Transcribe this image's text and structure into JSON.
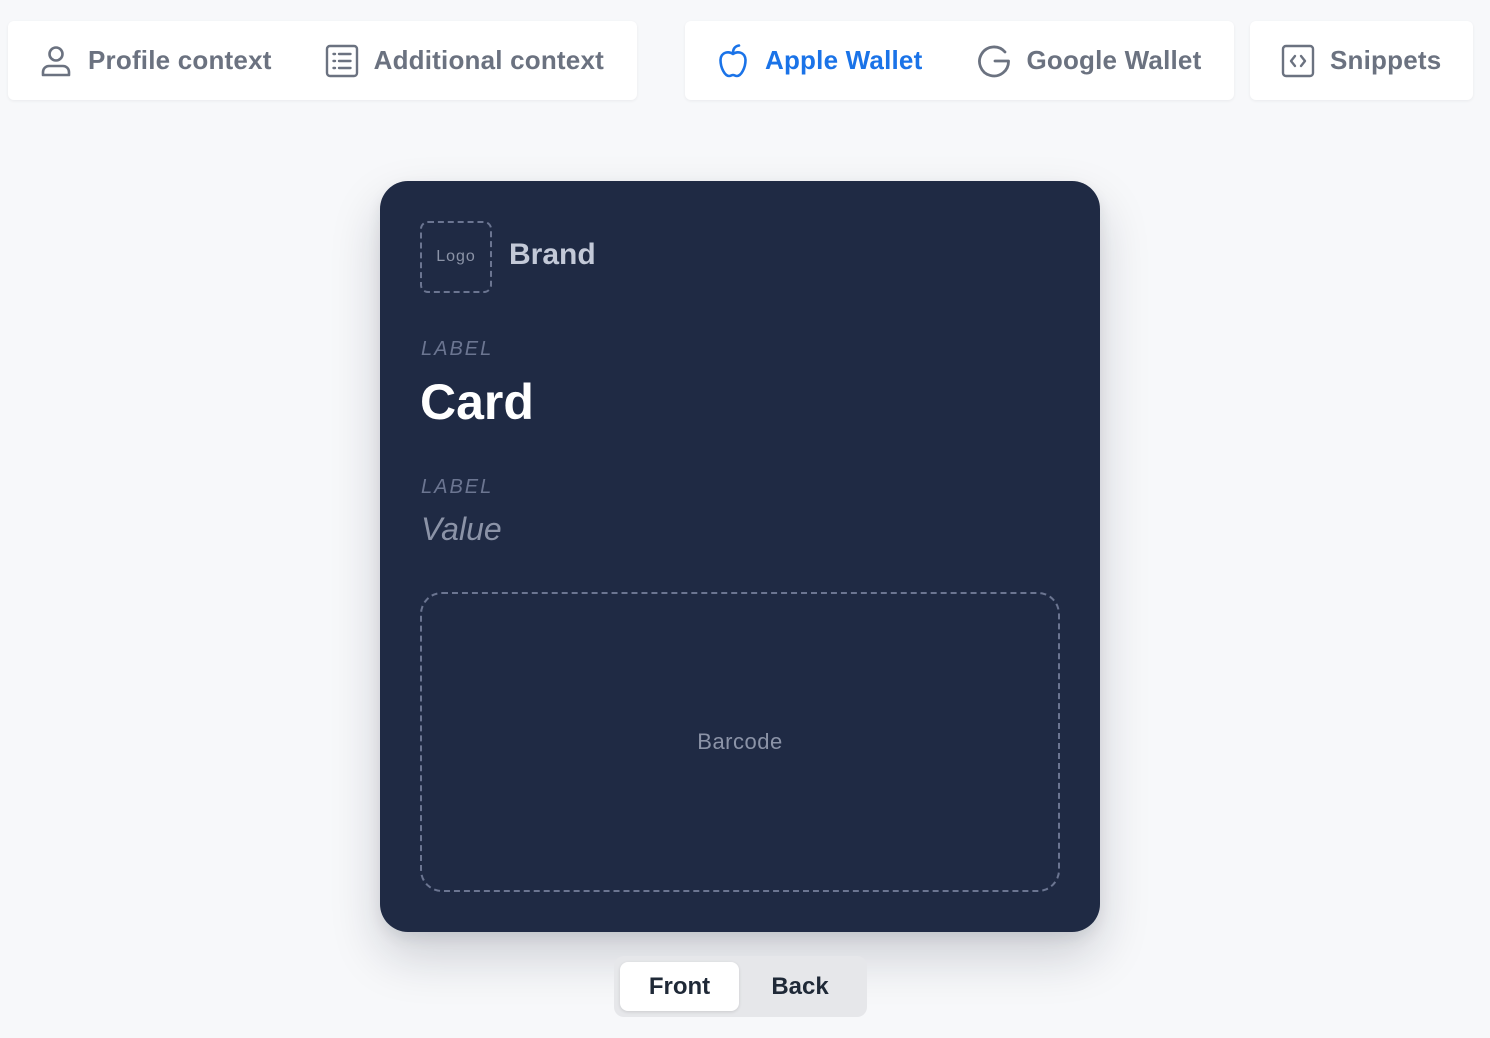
{
  "toolbar": {
    "context_group": {
      "profile_context": {
        "label": "Profile context",
        "icon": "user-icon"
      },
      "additional_context": {
        "label": "Additional context",
        "icon": "list-icon"
      }
    },
    "wallet_group": {
      "apple_wallet": {
        "label": "Apple Wallet",
        "icon": "apple-icon",
        "active": true
      },
      "google_wallet": {
        "label": "Google Wallet",
        "icon": "google-icon",
        "active": false
      }
    },
    "snippets": {
      "label": "Snippets",
      "icon": "code-icon"
    }
  },
  "pass": {
    "logo_placeholder": "Logo",
    "brand": "Brand",
    "primary_field": {
      "label": "LABEL",
      "value": "Card"
    },
    "secondary_field": {
      "label": "LABEL",
      "value": "Value"
    },
    "barcode_placeholder": "Barcode"
  },
  "side_toggle": {
    "options": [
      "Front",
      "Back"
    ],
    "selected": "Front"
  },
  "colors": {
    "accent": "#1a73e8",
    "card_background": "#1f2a44",
    "page_background": "#f7f8fa",
    "muted_text": "#6b7280"
  }
}
